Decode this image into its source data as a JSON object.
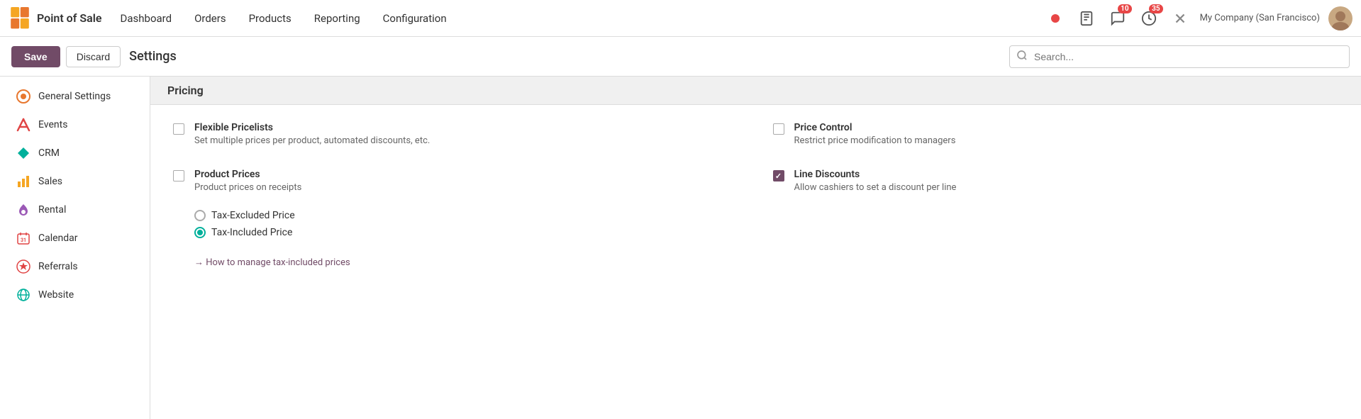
{
  "app": {
    "name": "Point of Sale",
    "logo_color1": "#F5A623",
    "logo_color2": "#E8772E"
  },
  "nav": {
    "items": [
      "Dashboard",
      "Orders",
      "Products",
      "Reporting",
      "Configuration"
    ],
    "company": "My Company (San Francisco)"
  },
  "toolbar": {
    "save_label": "Save",
    "discard_label": "Discard",
    "page_title": "Settings",
    "search_placeholder": "Search..."
  },
  "sidebar": {
    "items": [
      {
        "id": "general-settings",
        "label": "General Settings",
        "icon": "circle-orange"
      },
      {
        "id": "events",
        "label": "Events",
        "icon": "x-red"
      },
      {
        "id": "crm",
        "label": "CRM",
        "icon": "diamond-teal"
      },
      {
        "id": "sales",
        "label": "Sales",
        "icon": "bar-chart-orange"
      },
      {
        "id": "rental",
        "label": "Rental",
        "icon": "key-purple"
      },
      {
        "id": "calendar",
        "label": "Calendar",
        "icon": "calendar-red"
      },
      {
        "id": "referrals",
        "label": "Referrals",
        "icon": "star-circle"
      },
      {
        "id": "website",
        "label": "Website",
        "icon": "globe-teal"
      }
    ]
  },
  "content": {
    "section_title": "Pricing",
    "settings": [
      {
        "id": "flexible-pricelists",
        "col": 1,
        "row": 1,
        "label": "Flexible Pricelists",
        "description": "Set multiple prices per product, automated discounts, etc.",
        "checked": false
      },
      {
        "id": "price-control",
        "col": 2,
        "row": 1,
        "label": "Price Control",
        "description": "Restrict price modification to managers",
        "checked": false
      },
      {
        "id": "product-prices",
        "col": 1,
        "row": 2,
        "label": "Product Prices",
        "description": "Product prices on receipts",
        "checked": false,
        "has_radio": true,
        "radio_options": [
          {
            "label": "Tax-Excluded Price",
            "selected": false
          },
          {
            "label": "Tax-Included Price",
            "selected": true
          }
        ],
        "link": "→ How to manage tax-included prices"
      },
      {
        "id": "line-discounts",
        "col": 2,
        "row": 2,
        "label": "Line Discounts",
        "description": "Allow cashiers to set a discount per line",
        "checked": true
      }
    ]
  },
  "badges": {
    "chat_count": "10",
    "activity_count": "35"
  }
}
